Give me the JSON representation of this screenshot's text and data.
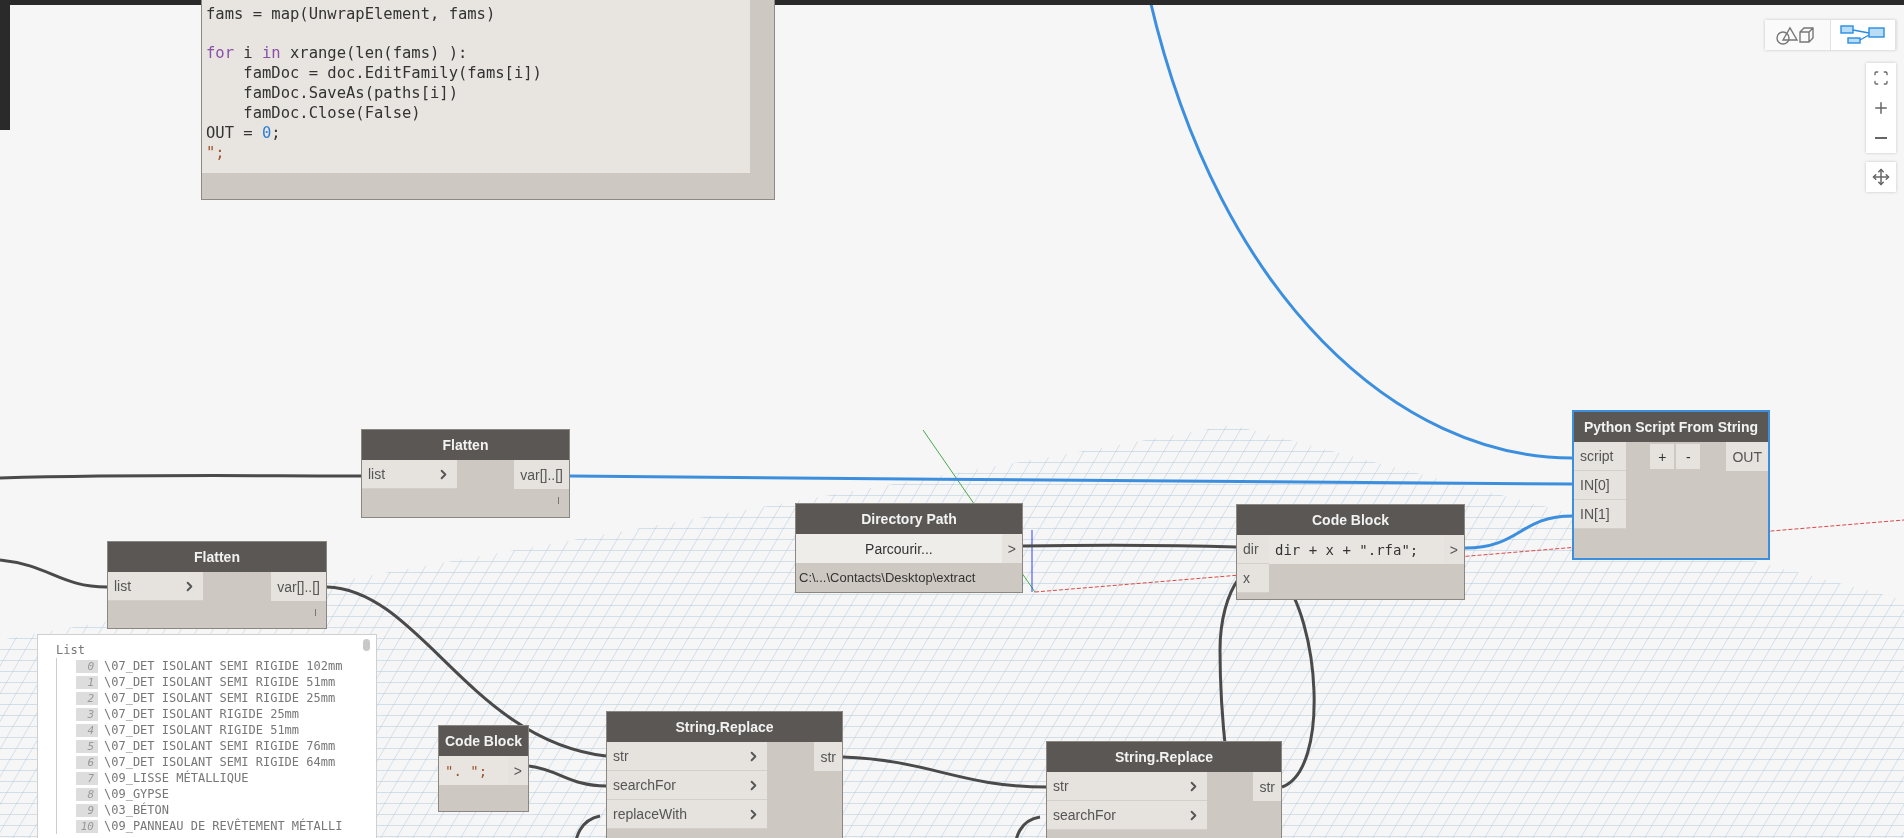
{
  "python_code": {
    "lines": [
      {
        "gap_before": false,
        "tokens": [
          {
            "kind": "plain",
            "text": "fams = map(UnwrapElement, fams)"
          }
        ]
      },
      {
        "gap_before": true,
        "tokens": [
          {
            "kind": "keyword",
            "text": "for"
          },
          {
            "kind": "plain",
            "text": " i "
          },
          {
            "kind": "keyword",
            "text": "in"
          },
          {
            "kind": "plain",
            "text": " xrange(len(fams) ):"
          }
        ]
      },
      {
        "gap_before": false,
        "tokens": [
          {
            "kind": "plain",
            "text": "    famDoc = doc.EditFamily(fams[i])"
          }
        ]
      },
      {
        "gap_before": false,
        "tokens": [
          {
            "kind": "plain",
            "text": "    famDoc.SaveAs(paths[i])"
          }
        ]
      },
      {
        "gap_before": false,
        "tokens": [
          {
            "kind": "plain",
            "text": "    famDoc.Close(False)"
          }
        ]
      },
      {
        "gap_before": false,
        "tokens": [
          {
            "kind": "plain",
            "text": "OUT = "
          },
          {
            "kind": "number",
            "text": "0"
          },
          {
            "kind": "plain",
            "text": ";"
          }
        ]
      },
      {
        "gap_before": false,
        "tokens": [
          {
            "kind": "string",
            "text": "\";"
          }
        ]
      }
    ]
  },
  "view_toggle": [
    {
      "kind": "geometry",
      "selected": false
    },
    {
      "kind": "graph",
      "selected": true
    }
  ],
  "nodes": [
    {
      "kind": "standard",
      "title": "Flatten",
      "selected": false,
      "inputs": [
        "list"
      ],
      "outputs": [
        "var[]..[]"
      ]
    },
    {
      "kind": "standard",
      "title": "Flatten",
      "selected": false,
      "inputs": [
        "list"
      ],
      "outputs": [
        "var[]..[]"
      ]
    },
    {
      "kind": "directory",
      "title": "Directory Path",
      "selected": false,
      "button": "Parcourir...",
      "output": ">",
      "path": "C:\\...\\Contacts\\Desktop\\extract"
    },
    {
      "kind": "code",
      "title": "Code Block",
      "selected": false,
      "inputs": [
        "dir",
        "x"
      ],
      "code": [
        {
          "kind": "plain",
          "text": "dir + x + \".rfa\";"
        }
      ],
      "output": ">"
    },
    {
      "kind": "python",
      "title": "Python Script From String",
      "selected": true,
      "inputs": [
        "script",
        "IN[0]",
        "IN[1]"
      ],
      "add": "+",
      "remove": "-",
      "output": "OUT"
    },
    {
      "kind": "code",
      "title": "Code Block",
      "selected": false,
      "code": [
        {
          "kind": "string",
          "text": "\". \";"
        }
      ],
      "output": ">"
    },
    {
      "kind": "standard",
      "title": "String.Replace",
      "selected": false,
      "inputs": [
        "str",
        "searchFor",
        "replaceWith"
      ],
      "outputs": [
        "str"
      ]
    },
    {
      "kind": "standard",
      "title": "String.Replace",
      "selected": false,
      "inputs": [
        "str",
        "searchFor"
      ],
      "outputs": [
        "str"
      ]
    }
  ],
  "list_preview": {
    "title": "List",
    "items": [
      {
        "index": "0",
        "value": "\\07_DET ISOLANT SEMI RIGIDE 102mm"
      },
      {
        "index": "1",
        "value": "\\07_DET ISOLANT SEMI RIGIDE 51mm"
      },
      {
        "index": "2",
        "value": "\\07_DET ISOLANT SEMI RIGIDE 25mm"
      },
      {
        "index": "3",
        "value": "\\07_DET ISOLANT RIGIDE 25mm"
      },
      {
        "index": "4",
        "value": "\\07_DET ISOLANT RIGIDE 51mm"
      },
      {
        "index": "5",
        "value": "\\07_DET ISOLANT SEMI RIGIDE 76mm"
      },
      {
        "index": "6",
        "value": "\\07_DET ISOLANT SEMI RIGIDE 64mm"
      },
      {
        "index": "7",
        "value": "\\09_LISSE MÉTALLIQUE"
      },
      {
        "index": "8",
        "value": "\\09_GYPSE"
      },
      {
        "index": "9",
        "value": "\\03_BÉTON"
      },
      {
        "index": "10",
        "value": "\\09_PANNEAU DE REVÊTEMENT MÉTALLI"
      }
    ]
  }
}
